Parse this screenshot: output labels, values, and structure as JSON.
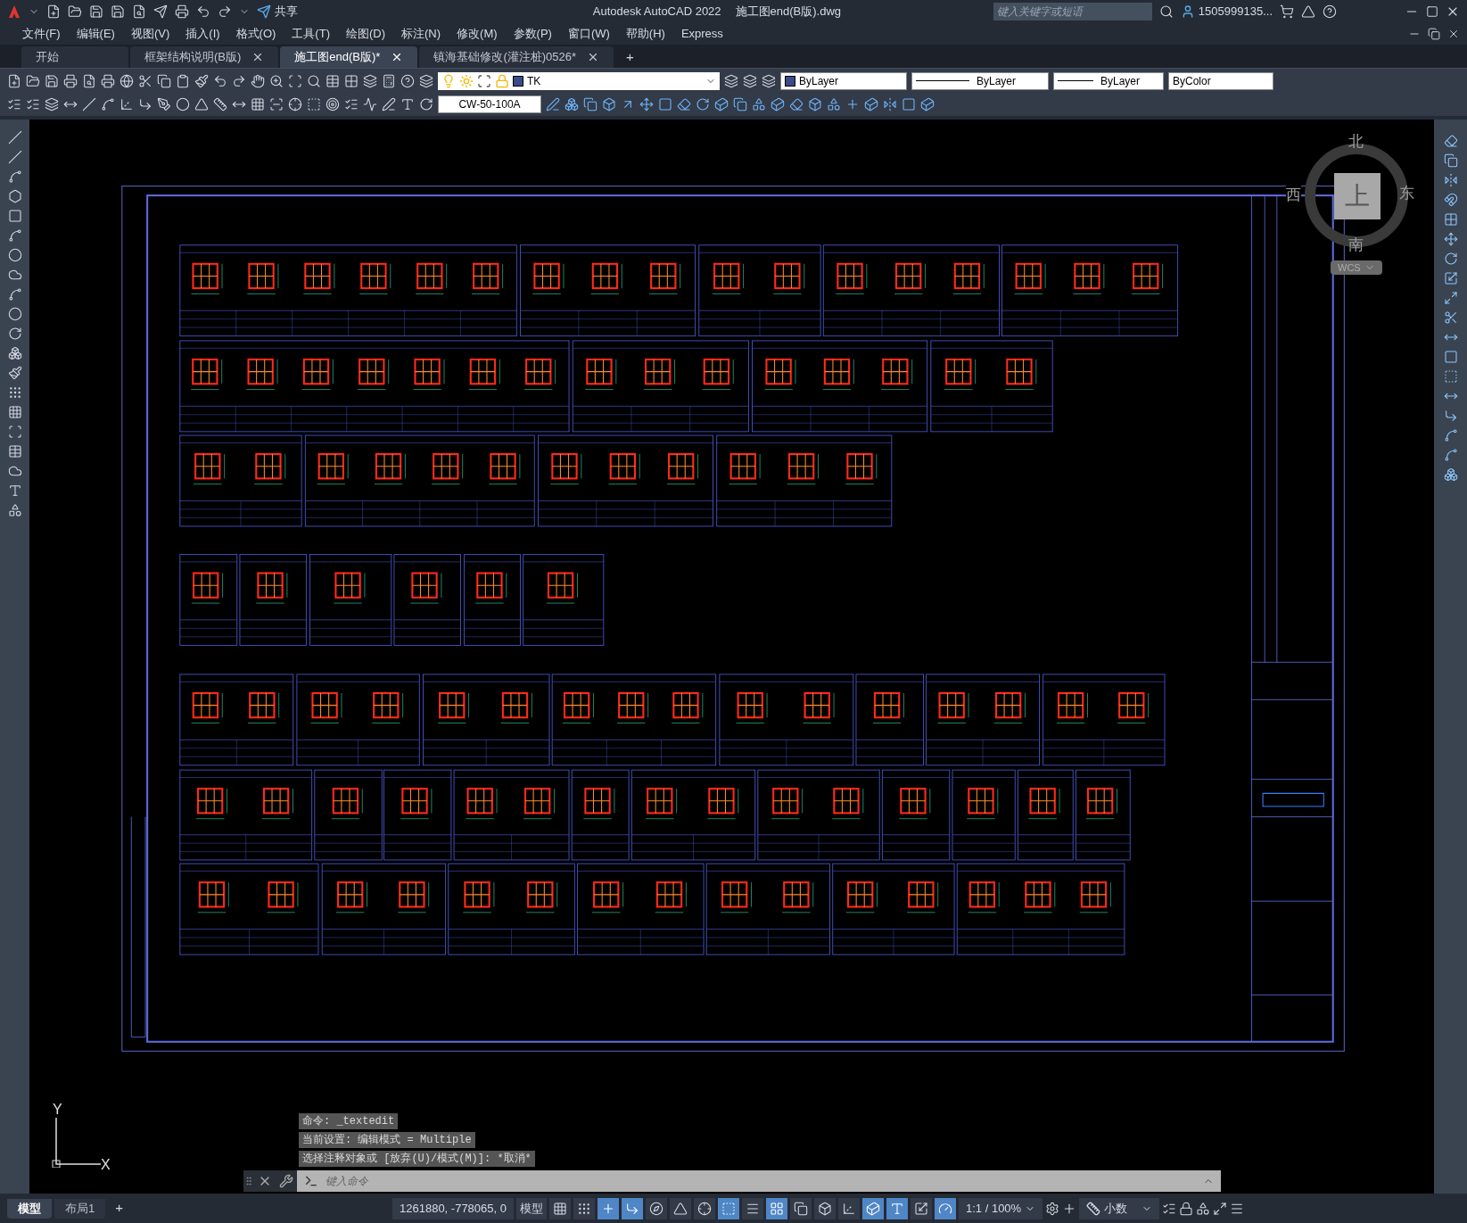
{
  "title_bar": {
    "share": "共享",
    "app_title": "Autodesk AutoCAD 2022",
    "file_title": "施工图end(B版).dwg",
    "search": {
      "placeholder": "键入关键字或短语"
    },
    "user": "1505999135..."
  },
  "menu": [
    "文件(F)",
    "编辑(E)",
    "视图(V)",
    "插入(I)",
    "格式(O)",
    "工具(T)",
    "绘图(D)",
    "标注(N)",
    "修改(M)",
    "参数(P)",
    "窗口(W)",
    "帮助(H)",
    "Express"
  ],
  "tabs": [
    {
      "label": "开始",
      "selected": false,
      "closable": false
    },
    {
      "label": "框架结构说明(B版)",
      "selected": false,
      "closable": true
    },
    {
      "label": "施工图end(B版)*",
      "selected": true,
      "closable": true
    },
    {
      "label": "镇海基础修改(灌注桩)0526*",
      "selected": false,
      "closable": true
    }
  ],
  "add_tab": "+",
  "toolbar": {
    "layer": "TK",
    "color_control": "ByLayer",
    "linetype": "ByLayer",
    "lineweight": "ByLayer",
    "plot_style": "ByColor",
    "dim_style": "CW-50-100A"
  },
  "viewcube": {
    "north": "北",
    "east": "东",
    "south": "南",
    "west": "西",
    "face": "上",
    "ucs": "WCS"
  },
  "ucs_icon": {
    "y": "Y",
    "x": "X"
  },
  "command_history": [
    "命令: _textedit",
    "当前设置: 编辑模式 = Multiple",
    "选择注释对象或 [放弃(U)/模式(M)]: *取消*"
  ],
  "command_line": {
    "placeholder": "键入命令"
  },
  "layout_tabs": [
    {
      "label": "模型",
      "selected": true
    },
    {
      "label": "布局1",
      "selected": false
    }
  ],
  "add_layout": "+",
  "status_bar": {
    "coordinates": "1261880, -778065, 0",
    "space": "模型",
    "scale": "1:1 / 100%",
    "units": "小数",
    "toggles": [
      {
        "kind": "grid",
        "on": false
      },
      {
        "kind": "snap",
        "on": false
      },
      {
        "kind": "infer",
        "on": true
      },
      {
        "kind": "ortho",
        "on": true
      },
      {
        "kind": "polar",
        "on": false
      },
      {
        "kind": "isodraft",
        "on": false
      },
      {
        "kind": "otrack",
        "on": false
      },
      {
        "kind": "osnap",
        "on": true
      },
      {
        "kind": "lineweight",
        "on": false
      },
      {
        "kind": "transparency",
        "on": true
      },
      {
        "kind": "selectioncycling",
        "on": false
      },
      {
        "kind": "gizmo",
        "on": false
      },
      {
        "kind": "dynamicucs",
        "on": false
      },
      {
        "kind": "osnap3d",
        "on": true
      },
      {
        "kind": "annotationvisibility",
        "on": true
      },
      {
        "kind": "autoscale",
        "on": false
      },
      {
        "kind": "hardwareacceleration",
        "on": true
      }
    ]
  }
}
